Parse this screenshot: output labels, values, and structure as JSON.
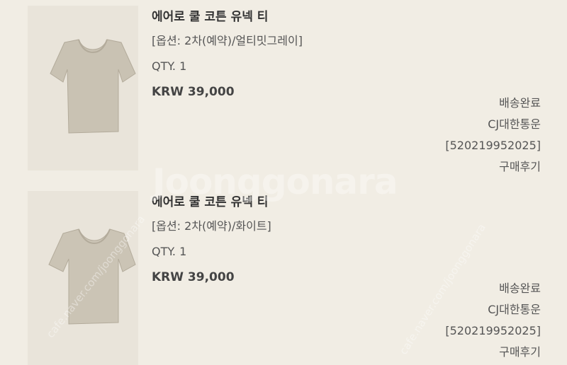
{
  "orders": [
    {
      "product_name": "에어로 쿨 코튼 유넥 티",
      "option": "[옵션: 2차(예약)/얼티밋그레이]",
      "qty": "QTY. 1",
      "price": "KRW 39,000",
      "status": "배송완료",
      "carrier": "CJ대한통운",
      "tracking": "[520219952025]",
      "review_link": "구매후기",
      "thumb_color": "#c9c2b3"
    },
    {
      "product_name": "에어로 쿨 코튼 유넥 티",
      "option": "[옵션: 2차(예약)/화이트]",
      "qty": "QTY. 1",
      "price": "KRW 39,000",
      "status": "배송완료",
      "carrier": "CJ대한통운",
      "tracking": "[520219952025]",
      "review_link": "구매후기",
      "thumb_color": "#cbc4b5"
    }
  ],
  "watermark": {
    "main": "Joonggonara",
    "url1": "cafe.naver.com/joonggonara",
    "url2": "cafe.naver.com/joonggonara"
  },
  "colors": {
    "background": "#f1ede4",
    "thumb_bg": "#e9e4da"
  }
}
